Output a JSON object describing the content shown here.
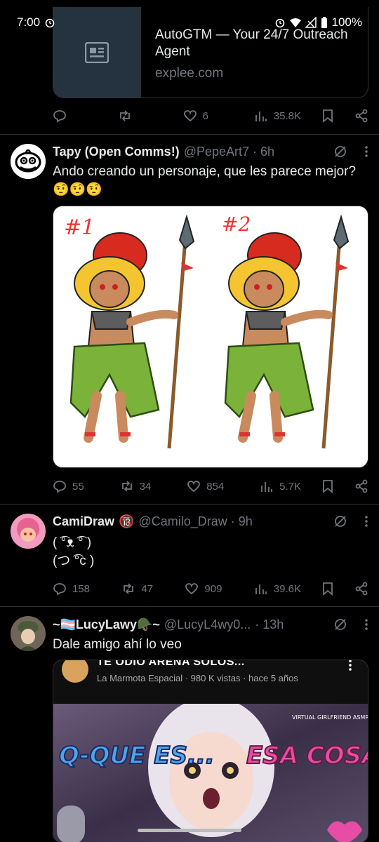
{
  "status": {
    "time": "7:00",
    "battery": "100%"
  },
  "card": {
    "title": "AutoGTM — Your 24/7 Outreach Agent",
    "domain": "explee.com"
  },
  "post0": {
    "reply": "",
    "retweet": "",
    "likes": "6",
    "views": "35.8K"
  },
  "post1": {
    "name": "Tapy (Open Comms!)",
    "handle": "@PepeArt7 · 6h",
    "text": "Ando creando un personaje, que les parece mejor? 🤨🤨🤨",
    "label1": "#1",
    "label2": "#2",
    "replies": "55",
    "retweets": "34",
    "likes": "854",
    "views": "5.7K"
  },
  "post2": {
    "name": "CamiDraw",
    "badge": "🔞",
    "handle": "@Camilo_Draw · 9h",
    "line1": "( ͡°ᴥ ͡° )",
    "line2": "(つ ͡°c )",
    "replies": "158",
    "retweets": "47",
    "likes": "909",
    "views": "39.6K"
  },
  "post3": {
    "name": "~🏳️‍⚧️LucyLawy🪖~",
    "handle": "@LucyL4wy0...",
    "time": "· 13h",
    "text": "Dale amigo ahí lo veo",
    "video_title": "TE ODIO ARENA SOLOS...",
    "video_meta": "La Marmota Espacial · 980 K vistas · hace 5 años",
    "thumb_tag": "VIRTUAL GIRLFRIEND ASMR",
    "thumb_left": "Q-QUE ES...",
    "thumb_right": "ESA COSA ?"
  },
  "colors": {
    "bg": "#000000",
    "text": "#e7e9ea",
    "muted": "#71767b",
    "divider": "#2f3336"
  }
}
